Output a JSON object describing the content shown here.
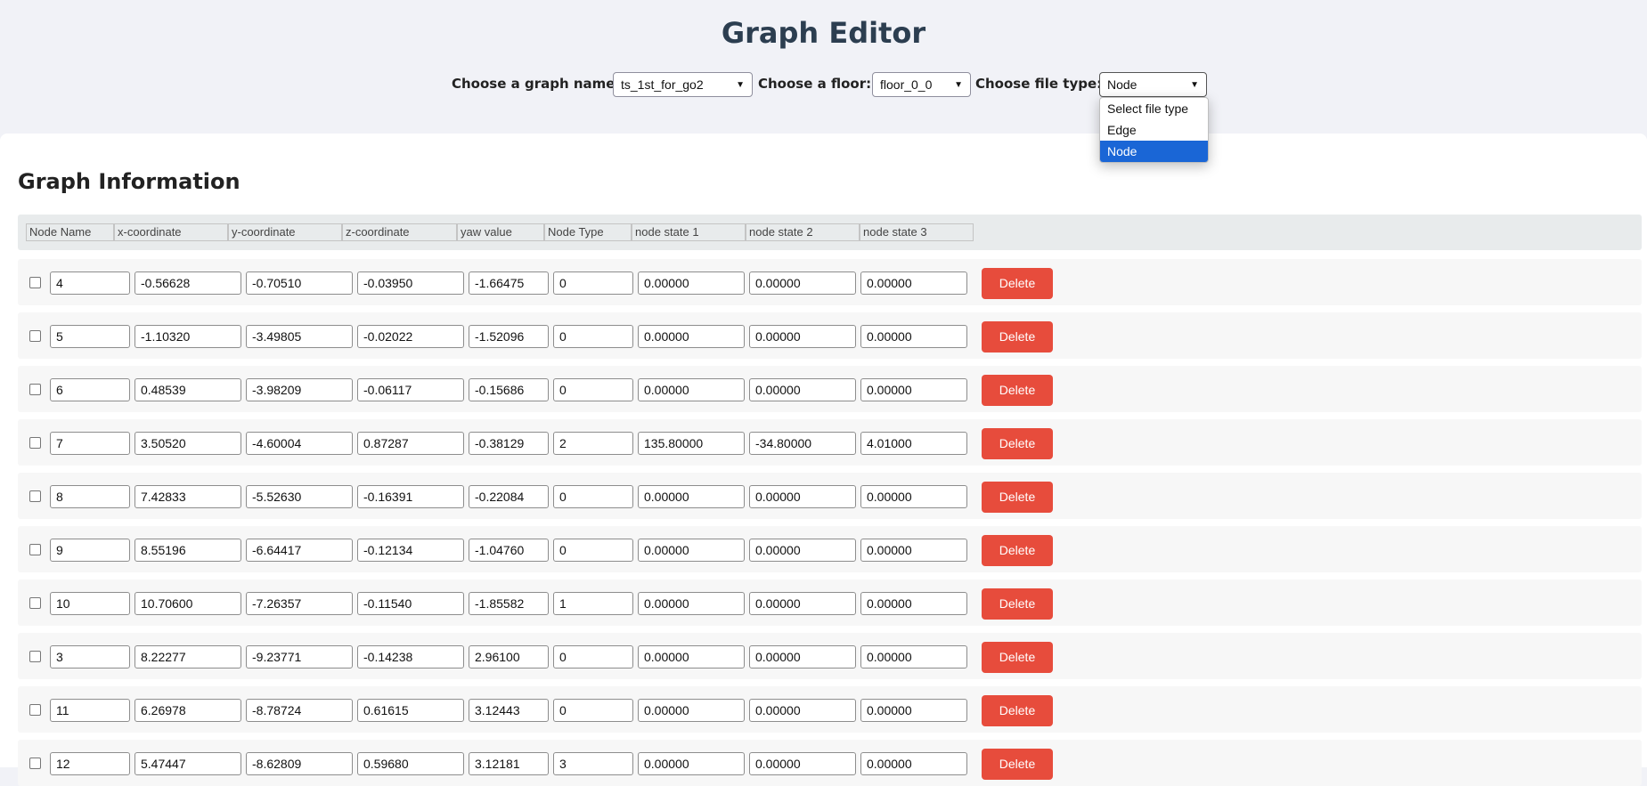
{
  "title": "Graph Editor",
  "controls": {
    "graph_label": "Choose a graph name:",
    "graph_value": "ts_1st_for_go2",
    "floor_label": "Choose a floor:",
    "floor_value": "floor_0_0",
    "filetype_label": "Choose file type:",
    "filetype_value": "Node",
    "filetype_options": [
      "Select file type",
      "Edge",
      "Node"
    ]
  },
  "section_title": "Graph Information",
  "columns": [
    "Node Name",
    "x-coordinate",
    "y-coordinate",
    "z-coordinate",
    "yaw value",
    "Node Type",
    "node state 1",
    "node state 2",
    "node state 3"
  ],
  "delete_label": "Delete",
  "rows": [
    [
      "4",
      "-0.56628",
      "-0.70510",
      "-0.03950",
      "-1.66475",
      "0",
      "0.00000",
      "0.00000",
      "0.00000"
    ],
    [
      "5",
      "-1.10320",
      "-3.49805",
      "-0.02022",
      "-1.52096",
      "0",
      "0.00000",
      "0.00000",
      "0.00000"
    ],
    [
      "6",
      "0.48539",
      "-3.98209",
      "-0.06117",
      "-0.15686",
      "0",
      "0.00000",
      "0.00000",
      "0.00000"
    ],
    [
      "7",
      "3.50520",
      "-4.60004",
      "0.87287",
      "-0.38129",
      "2",
      "135.80000",
      "-34.80000",
      "4.01000"
    ],
    [
      "8",
      "7.42833",
      "-5.52630",
      "-0.16391",
      "-0.22084",
      "0",
      "0.00000",
      "0.00000",
      "0.00000"
    ],
    [
      "9",
      "8.55196",
      "-6.64417",
      "-0.12134",
      "-1.04760",
      "0",
      "0.00000",
      "0.00000",
      "0.00000"
    ],
    [
      "10",
      "10.70600",
      "-7.26357",
      "-0.11540",
      "-1.85582",
      "1",
      "0.00000",
      "0.00000",
      "0.00000"
    ],
    [
      "3",
      "8.22277",
      "-9.23771",
      "-0.14238",
      "2.96100",
      "0",
      "0.00000",
      "0.00000",
      "0.00000"
    ],
    [
      "11",
      "6.26978",
      "-8.78724",
      "0.61615",
      "3.12443",
      "0",
      "0.00000",
      "0.00000",
      "0.00000"
    ],
    [
      "12",
      "5.47447",
      "-8.62809",
      "0.59680",
      "3.12181",
      "3",
      "0.00000",
      "0.00000",
      "0.00000"
    ]
  ]
}
